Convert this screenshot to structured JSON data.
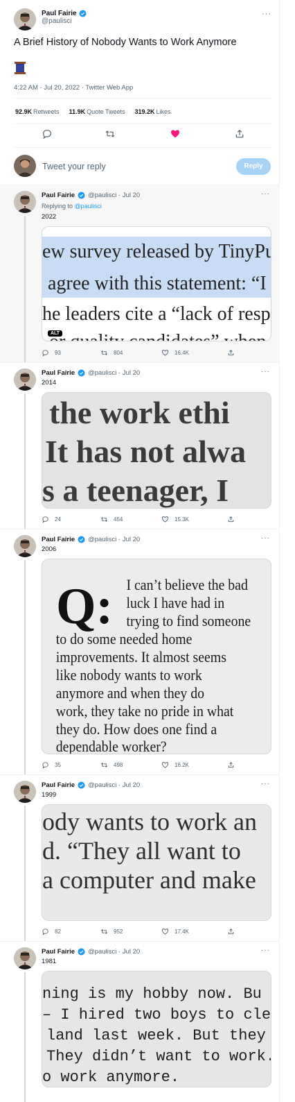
{
  "author": {
    "name": "Paul Fairie",
    "handle": "@paulisci"
  },
  "main_tweet": {
    "text": "A Brief History of Nobody Wants to Work Anymore",
    "emoji": "spool-of-thread",
    "meta": "4:22 AM · Jul 20, 2022 · Twitter Web App",
    "stats": [
      {
        "value": "92.9K",
        "label": "Retweets"
      },
      {
        "value": "11.9K",
        "label": "Quote Tweets"
      },
      {
        "value": "319.2K",
        "label": "Likes"
      }
    ]
  },
  "reply_box": {
    "placeholder": "Tweet your reply",
    "button": "Reply"
  },
  "replies": [
    {
      "handle_date": "@paulisci · Jul 20",
      "replying_prefix": "Replying to",
      "replying_to": "@paulisci",
      "text": "2022",
      "image_lines": [
        "ew survey released by TinyPu",
        "agree with this statement: “I",
        "he leaders cite a “lack of respo",
        "or quality candidates” when"
      ],
      "alt": "ALT",
      "replies": "93",
      "retweets": "804",
      "likes": "16.4K"
    },
    {
      "handle_date": "@paulisci · Jul 20",
      "text": "2014",
      "image_lines": [
        "the work ethi",
        "It has not alwa",
        "s a teenager, I"
      ],
      "replies": "24",
      "retweets": "454",
      "likes": "15.3K"
    },
    {
      "handle_date": "@paulisci · Jul 20",
      "text": "2006",
      "image_lines": [
        "I can’t believe the bad",
        "luck I have had in",
        "trying to find someone",
        "to do some needed home",
        "improvements. It almost seems",
        "like nobody wants to work",
        "anymore and when they do",
        "work, they take no pride in what",
        "they do. How does one find a",
        "dependable worker?"
      ],
      "image_q": "Q:",
      "replies": "35",
      "retweets": "498",
      "likes": "16.2K"
    },
    {
      "handle_date": "@paulisci · Jul 20",
      "text": "1999",
      "image_lines": [
        "ody wants to work an",
        "d. “They all want to",
        "a computer and make"
      ],
      "replies": "82",
      "retweets": "952",
      "likes": "17.4K"
    },
    {
      "handle_date": "@paulisci · Jul 20",
      "text": "1981",
      "image_lines": [
        "ning is my hobby now. Bu",
        "– I hired two boys to clear th",
        "land last week. But they just",
        "They didn’t want to work.",
        "o work anymore."
      ]
    }
  ],
  "colors": {
    "accent": "#1d9bf0",
    "like": "#f91880",
    "muted": "#536471"
  }
}
